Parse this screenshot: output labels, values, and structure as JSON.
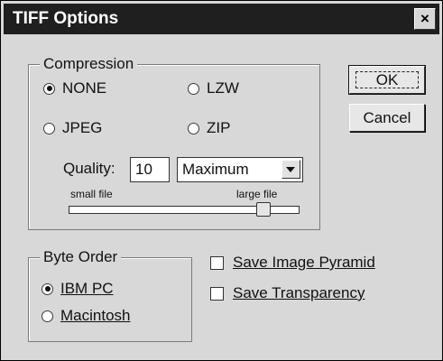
{
  "window": {
    "title": "TIFF Options",
    "close_glyph": "×"
  },
  "compression": {
    "label": "Compression",
    "options": [
      {
        "label": "NONE",
        "selected": true
      },
      {
        "label": "LZW",
        "selected": false
      },
      {
        "label": "JPEG",
        "selected": false
      },
      {
        "label": "ZIP",
        "selected": false
      }
    ],
    "quality_label": "Quality:",
    "quality_value": "10",
    "quality_preset": "Maximum",
    "slider_min_label": "small file",
    "slider_max_label": "large file"
  },
  "buttons": {
    "ok": "OK",
    "cancel": "Cancel"
  },
  "byte_order": {
    "label": "Byte Order",
    "options": [
      {
        "label": "IBM PC",
        "selected": true
      },
      {
        "label": "Macintosh",
        "selected": false
      }
    ]
  },
  "checkboxes": [
    {
      "label": "Save Image Pyramid",
      "checked": false
    },
    {
      "label": "Save Transparency",
      "checked": false
    }
  ]
}
